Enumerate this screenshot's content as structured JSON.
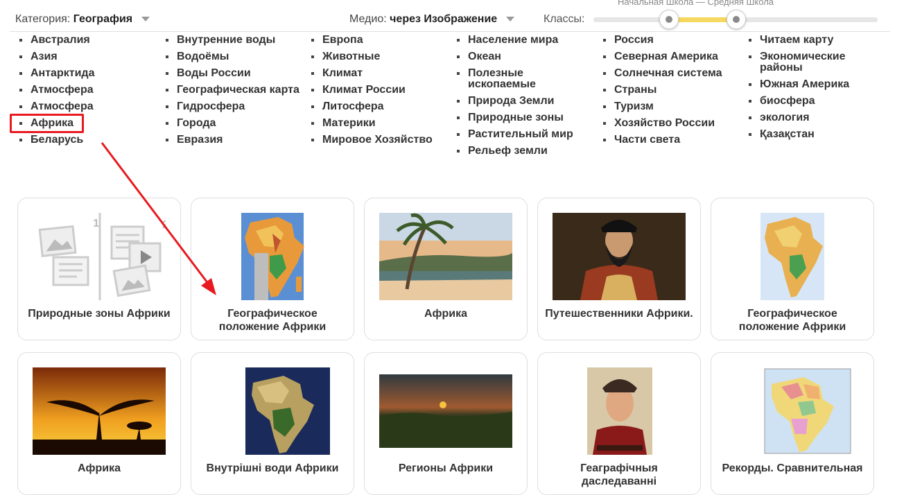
{
  "header": {
    "category_label": "Категория:",
    "category_value": "География",
    "medio_label": "Медио:",
    "medio_value": "через Изображение",
    "classes_label": "Классы:",
    "range_label": "Начальная Школа — Средняя Школа",
    "range_low": 0.27,
    "range_high": 0.5
  },
  "topics": {
    "col1": [
      "Австралия",
      "Азия",
      "Антарктида",
      "Атмосфера",
      "Атмосфера",
      "Африка",
      "Беларусь"
    ],
    "col2": [
      "Внутренние воды",
      "Водоёмы",
      "Воды России",
      "Географическая карта",
      "Гидросфера",
      "Города",
      "Евразия"
    ],
    "col3": [
      "Европа",
      "Животные",
      "Климат",
      "Климат России",
      "Литосфера",
      "Материки",
      "Мировое Хозяйство"
    ],
    "col4": [
      "Население мира",
      "Океан",
      "Полезные ископаемые",
      "Природа Земли",
      "Природные зоны",
      "Растительный мир",
      "Рельеф земли"
    ],
    "col5": [
      "Россия",
      "Северная Америка",
      "Солнечная система",
      "Страны",
      "Туризм",
      "Хозяйство России",
      "Части света"
    ],
    "col6": [
      "Читаем карту",
      "Экономические районы",
      "Южная Америка",
      "биосфера",
      "экология",
      "Қазақстан"
    ],
    "selected": "Африка"
  },
  "cards": [
    {
      "title": "Природные зоны Африки",
      "thumb": "placeholder-illustration",
      "num1": "1",
      "num2": "2"
    },
    {
      "title": "Географическое положение Африки",
      "thumb": "africa-physical-map"
    },
    {
      "title": "Африка",
      "thumb": "oasis-palm-photo"
    },
    {
      "title": "Путешественники Африки.",
      "thumb": "explorer-portrait"
    },
    {
      "title": "Географическое положение Африки",
      "thumb": "africa-physical-map-small"
    },
    {
      "title": "Африка",
      "thumb": "savanna-sunset-photo"
    },
    {
      "title": "Внутрішні води Африки",
      "thumb": "africa-satellite-map"
    },
    {
      "title": "Регионы Африки",
      "thumb": "sunset-landscape-photo"
    },
    {
      "title": "Геаграфічныя даследаванні",
      "thumb": "explorer-portrait-2"
    },
    {
      "title": "Рекорды. Сравнительная",
      "thumb": "africa-political-map"
    }
  ],
  "colors": {
    "highlight": "#e8191f",
    "arrow": "#e8191f",
    "slider_fill": "#f6d860"
  }
}
